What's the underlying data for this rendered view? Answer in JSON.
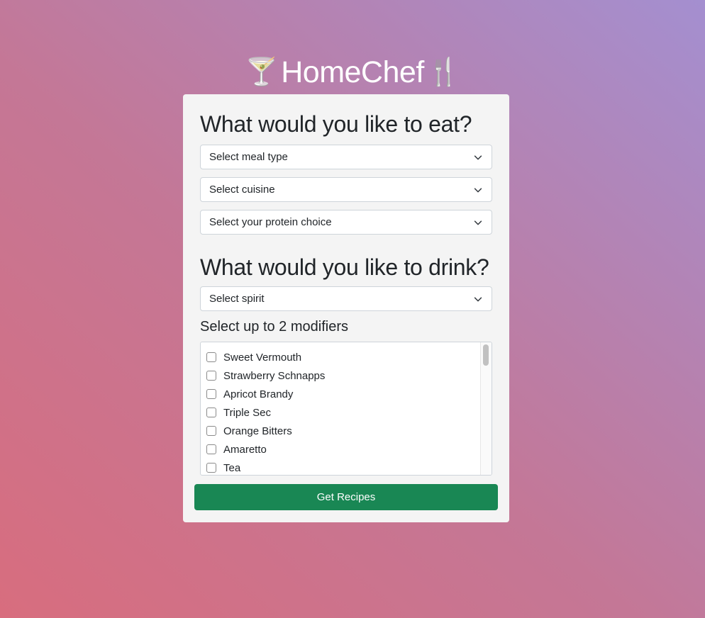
{
  "app": {
    "title": "HomeChef",
    "left_emoji": "🍸",
    "right_emoji": "🍴"
  },
  "food_section": {
    "heading": "What would you like to eat?",
    "meal_type_placeholder": "Select meal type",
    "cuisine_placeholder": "Select cuisine",
    "protein_placeholder": "Select your protein choice"
  },
  "drink_section": {
    "heading": "What would you like to drink?",
    "spirit_placeholder": "Select spirit",
    "modifiers_label": "Select up to 2 modifiers",
    "modifiers": [
      {
        "label": "Sweet Vermouth",
        "checked": false
      },
      {
        "label": "Strawberry Schnapps",
        "checked": false
      },
      {
        "label": "Apricot Brandy",
        "checked": false
      },
      {
        "label": "Triple Sec",
        "checked": false
      },
      {
        "label": "Orange Bitters",
        "checked": false
      },
      {
        "label": "Amaretto",
        "checked": false
      },
      {
        "label": "Tea",
        "checked": false
      }
    ]
  },
  "submit_label": "Get Recipes",
  "colors": {
    "button": "#198754",
    "card": "#f4f4f4"
  },
  "icons": {
    "select_arrow": "chevron-down-icon",
    "checkbox": "checkbox-icon"
  }
}
